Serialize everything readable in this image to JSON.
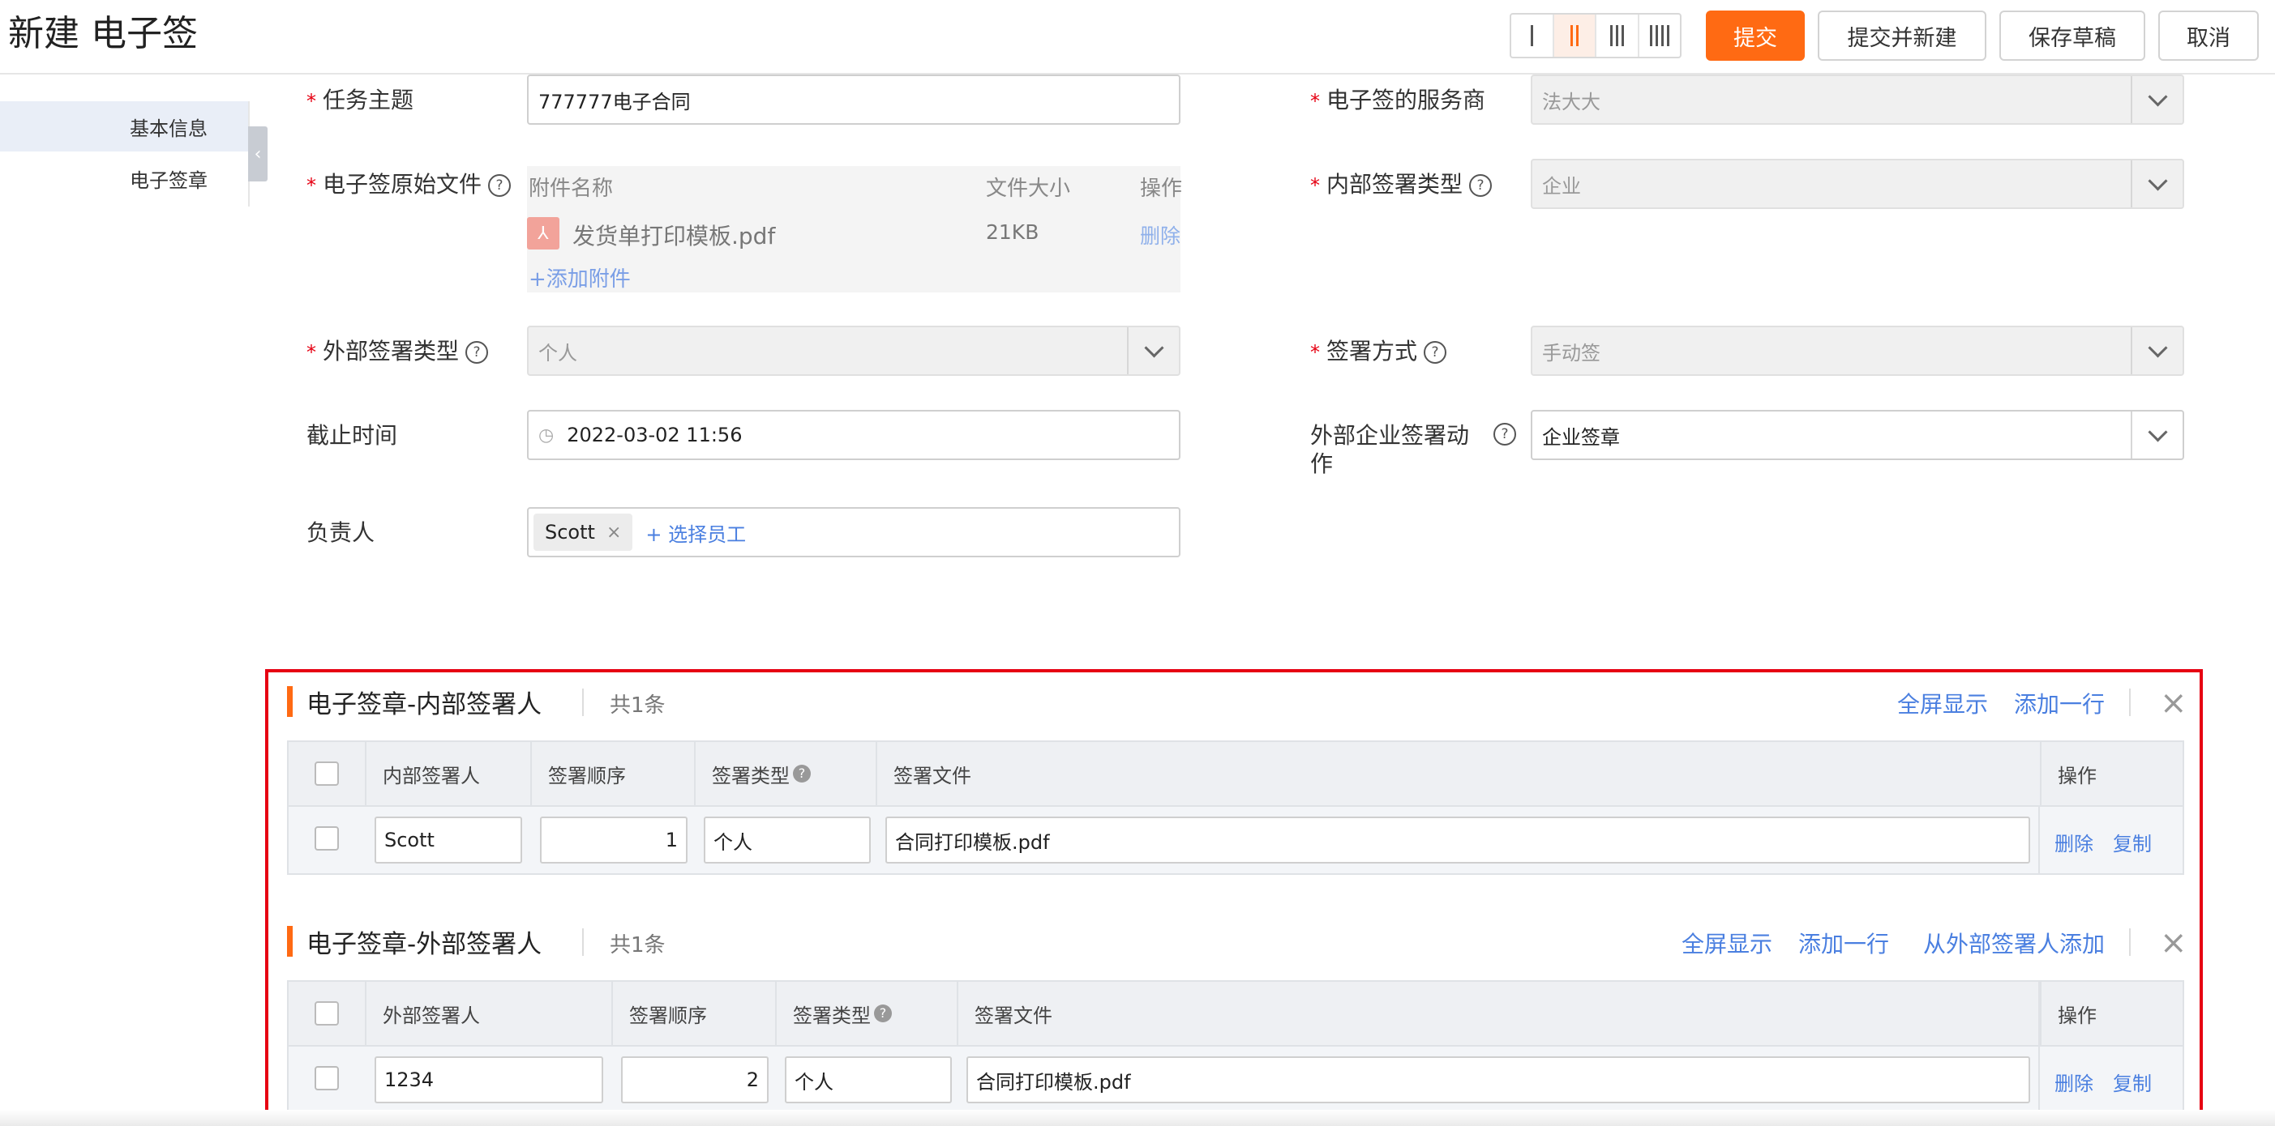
{
  "header": {
    "title": "新建 电子签",
    "buttons": {
      "submit": "提交",
      "submit_new": "提交并新建",
      "save_draft": "保存草稿",
      "cancel": "取消"
    }
  },
  "sidebar": {
    "items": [
      {
        "label": "基本信息",
        "active": true
      },
      {
        "label": "电子签章",
        "active": false
      }
    ]
  },
  "form": {
    "task_subject": {
      "label": "任务主题",
      "value": "777777电子合同"
    },
    "original_file": {
      "label": "电子签原始文件",
      "columns": [
        "附件名称",
        "文件大小",
        "操作"
      ],
      "file": {
        "name": "发货单打印模板.pdf",
        "size": "21KB",
        "action": "删除"
      },
      "add": "+添加附件"
    },
    "external_sign_type": {
      "label": "外部签署类型",
      "value": "个人"
    },
    "deadline": {
      "label": "截止时间",
      "value": "2022-03-02 11:56"
    },
    "owner": {
      "label": "负责人",
      "tag": "Scott",
      "add": "+ 选择员工"
    },
    "provider": {
      "label": "电子签的服务商",
      "value": "法大大"
    },
    "internal_sign_type": {
      "label": "内部签署类型",
      "value": "企业"
    },
    "sign_method": {
      "label": "签署方式",
      "value": "手动签"
    },
    "ext_action": {
      "label_line1": "外部企业签署动",
      "label_line2": "作",
      "value": "企业签章"
    }
  },
  "internal_table": {
    "title": "电子签章-内部签署人",
    "count": "共1条",
    "actions": {
      "fullscreen": "全屏显示",
      "add_row": "添加一行"
    },
    "columns": [
      "内部签署人",
      "签署顺序",
      "签署类型",
      "签署文件",
      "操作"
    ],
    "rows": [
      {
        "signer": "Scott",
        "order": "1",
        "type": "个人",
        "file": "合同打印模板.pdf",
        "delete": "删除",
        "copy": "复制"
      }
    ]
  },
  "external_table": {
    "title": "电子签章-外部签署人",
    "count": "共1条",
    "actions": {
      "fullscreen": "全屏显示",
      "add_row": "添加一行",
      "add_from_external": "从外部签署人添加"
    },
    "columns": [
      "外部签署人",
      "签署顺序",
      "签署类型",
      "签署文件",
      "操作"
    ],
    "rows": [
      {
        "signer": "1234",
        "order": "2",
        "type": "个人",
        "file": "合同打印模板.pdf",
        "delete": "删除",
        "copy": "复制"
      }
    ]
  },
  "colors": {
    "accent": "#ff6a13",
    "link": "#4a7fe0",
    "required": "#e60012",
    "highlight_frame": "#e60012"
  }
}
